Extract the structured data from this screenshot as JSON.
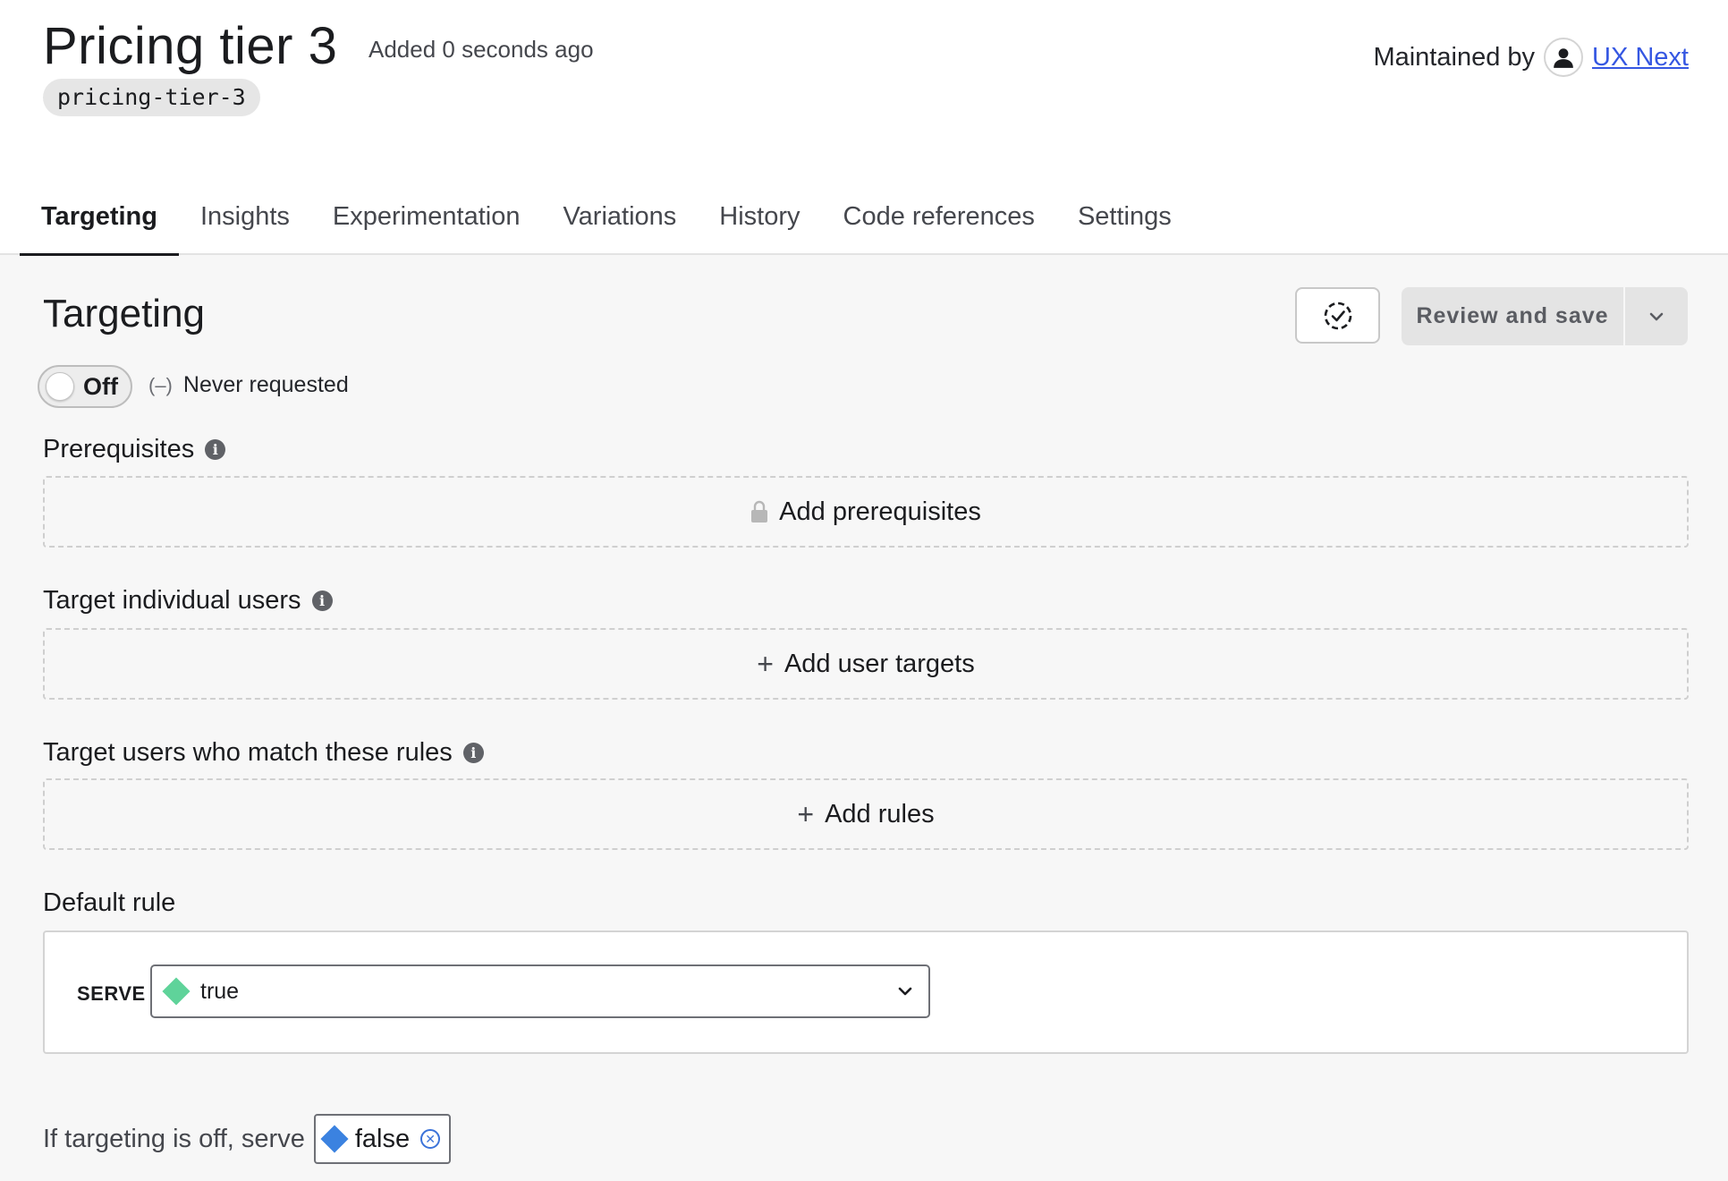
{
  "header": {
    "title": "Pricing tier 3",
    "added": "Added 0 seconds ago",
    "key": "pricing-tier-3",
    "maintained_by_label": "Maintained by",
    "maintainer": "UX Next"
  },
  "tabs": [
    {
      "label": "Targeting",
      "active": true
    },
    {
      "label": "Insights"
    },
    {
      "label": "Experimentation"
    },
    {
      "label": "Variations"
    },
    {
      "label": "History"
    },
    {
      "label": "Code references"
    },
    {
      "label": "Settings"
    }
  ],
  "targeting": {
    "title": "Targeting",
    "review_label": "Review and save",
    "toggle_label": "Off",
    "status": "Never requested",
    "status_icon": "(–)"
  },
  "prerequisites": {
    "label": "Prerequisites",
    "button": "Add prerequisites"
  },
  "individual": {
    "label": "Target individual users",
    "button": "Add user targets"
  },
  "rules": {
    "label": "Target users who match these rules",
    "button": "Add rules"
  },
  "default_rule": {
    "label": "Default rule",
    "serve_label": "SERVE",
    "value": "true",
    "value_color": "#5fd39a"
  },
  "off_variation": {
    "label": "If targeting is off, serve",
    "value": "false",
    "value_color": "#3b82e0"
  },
  "icons": {
    "info": "i",
    "plus": "+",
    "clear": "✕"
  },
  "colors": {
    "link": "#3557e2",
    "text": "#1b1c1f"
  }
}
